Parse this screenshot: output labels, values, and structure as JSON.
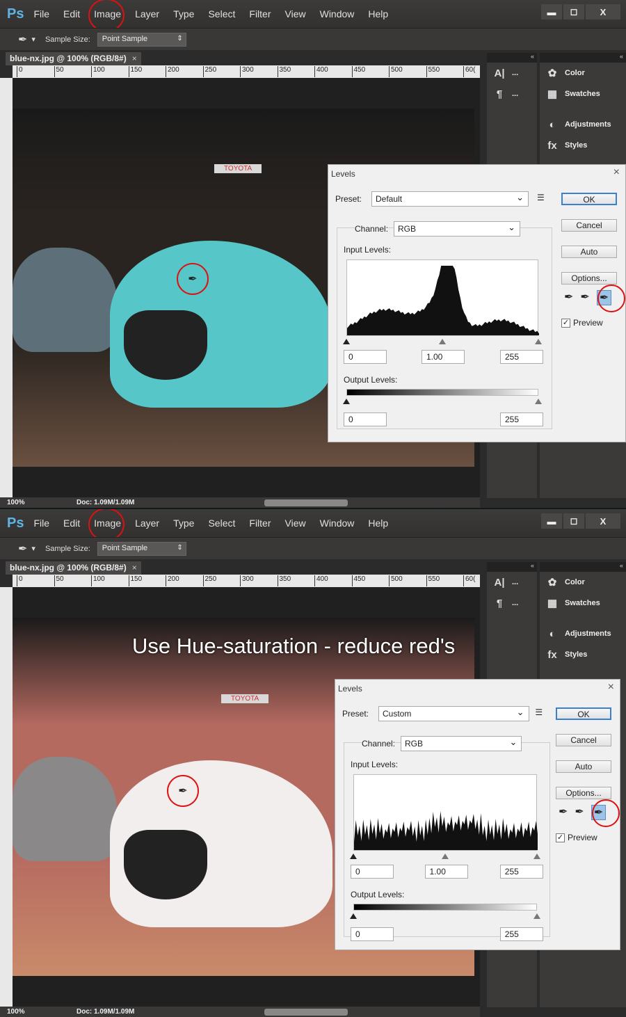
{
  "screens": [
    {
      "app_logo": "Ps",
      "menu": [
        "File",
        "Edit",
        "Image",
        "Layer",
        "Type",
        "Select",
        "Filter",
        "View",
        "Window",
        "Help"
      ],
      "circled_menu": "Image",
      "window_controls": [
        "▬",
        "◻",
        "X"
      ],
      "options": {
        "tool_icon": "eyedropper-icon",
        "sample_size_label": "Sample Size:",
        "sample_size_value": "Point Sample"
      },
      "tab": {
        "title": "blue-nx.jpg @ 100% (RGB/8#)",
        "close": "×"
      },
      "ruler_ticks": [
        "0",
        "50",
        "100",
        "150",
        "200",
        "250",
        "300",
        "350",
        "400",
        "450",
        "500",
        "550",
        "60("
      ],
      "status": {
        "zoom": "100%",
        "doc": "Doc: 1.09M/1.09M"
      },
      "panel_left": [
        {
          "icon": "A|",
          "label": "..."
        },
        {
          "icon": "¶",
          "label": "..."
        }
      ],
      "panel_right": [
        {
          "icon": "color-icon",
          "glyph": "✿",
          "label": "Color"
        },
        {
          "icon": "swatches-icon",
          "glyph": "▦",
          "label": "Swatches"
        },
        {
          "icon": "adjustments-icon",
          "glyph": "◐",
          "label": "Adjustments"
        },
        {
          "icon": "styles-icon",
          "glyph": "fx",
          "label": "Styles"
        }
      ],
      "photo": {
        "car_color": "#57c6c8",
        "scene_tint": "#2a2420",
        "booth_sign": "TOYOTA"
      },
      "levels": {
        "title": "Levels",
        "close": "×",
        "preset_label": "Preset:",
        "preset_value": "Default",
        "channel_label": "Channel:",
        "channel_value": "RGB",
        "input_label": "Input Levels:",
        "input_values": [
          "0",
          "1.00",
          "255"
        ],
        "output_label": "Output Levels:",
        "output_values": [
          "0",
          "255"
        ],
        "buttons": [
          "OK",
          "Cancel",
          "Auto",
          "Options..."
        ],
        "preview_label": "Preview",
        "preview_checked": true,
        "active_eyedropper": "white-point"
      }
    },
    {
      "app_logo": "Ps",
      "menu": [
        "File",
        "Edit",
        "Image",
        "Layer",
        "Type",
        "Select",
        "Filter",
        "View",
        "Window",
        "Help"
      ],
      "circled_menu": "Image",
      "window_controls": [
        "▬",
        "◻",
        "X"
      ],
      "options": {
        "tool_icon": "eyedropper-icon",
        "sample_size_label": "Sample Size:",
        "sample_size_value": "Point Sample"
      },
      "tab": {
        "title": "blue-nx.jpg @ 100% (RGB/8#)",
        "close": "×"
      },
      "ruler_ticks": [
        "0",
        "50",
        "100",
        "150",
        "200",
        "250",
        "300",
        "350",
        "400",
        "450",
        "500",
        "550",
        "60("
      ],
      "status": {
        "zoom": "100%",
        "doc": "Doc: 1.09M/1.09M"
      },
      "panel_left": [
        {
          "icon": "A|",
          "label": "..."
        },
        {
          "icon": "¶",
          "label": "..."
        }
      ],
      "panel_right": [
        {
          "icon": "color-icon",
          "glyph": "✿",
          "label": "Color"
        },
        {
          "icon": "swatches-icon",
          "glyph": "▦",
          "label": "Swatches"
        },
        {
          "icon": "adjustments-icon",
          "glyph": "◐",
          "label": "Adjustments"
        },
        {
          "icon": "styles-icon",
          "glyph": "fx",
          "label": "Styles"
        }
      ],
      "photo": {
        "car_color": "#f2eeee",
        "scene_tint": "#b56a60",
        "booth_sign": "TOYOTA"
      },
      "levels": {
        "title": "Levels",
        "close": "×",
        "preset_label": "Preset:",
        "preset_value": "Custom",
        "channel_label": "Channel:",
        "channel_value": "RGB",
        "input_label": "Input Levels:",
        "input_values": [
          "0",
          "1.00",
          "255"
        ],
        "output_label": "Output Levels:",
        "output_values": [
          "0",
          "255"
        ],
        "buttons": [
          "OK",
          "Cancel",
          "Auto",
          "Options..."
        ],
        "preview_label": "Preview",
        "preview_checked": true,
        "active_eyedropper": "white-point"
      }
    }
  ],
  "annotation": "Use Hue-saturation - reduce red's"
}
